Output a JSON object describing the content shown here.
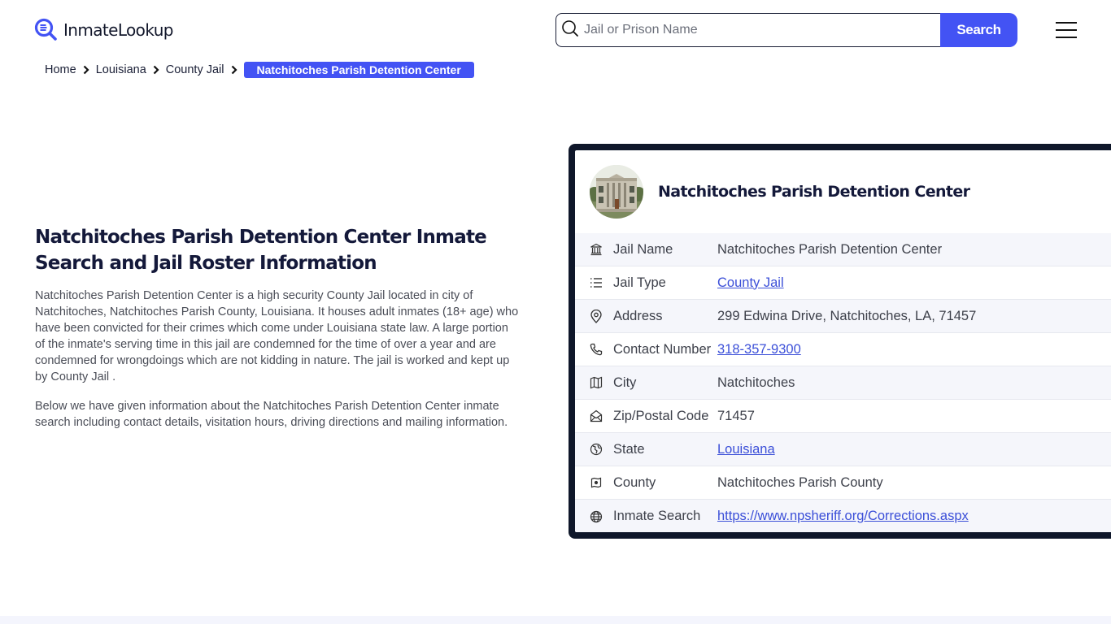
{
  "header": {
    "logo_text": "InmateLookup",
    "search": {
      "placeholder": "Jail or Prison Name",
      "value": "",
      "button_label": "Search"
    },
    "menu_icon": "hamburger-menu-icon"
  },
  "breadcrumb": {
    "items": [
      {
        "label": "Home"
      },
      {
        "label": "Louisiana"
      },
      {
        "label": "County Jail"
      }
    ],
    "current": "Natchitoches Parish Detention Center"
  },
  "intro": {
    "title": "Natchitoches Parish Detention Center Inmate Search and Jail Roster Information",
    "paragraphs": [
      "Natchitoches Parish Detention Center is a high security County Jail located in city of Natchitoches, Natchitoches Parish County, Louisiana. It houses adult inmates (18+ age) who have been convicted for their crimes which come under Louisiana state law. A large portion of the inmate's serving time in this jail are condemned for the time of over a year and are condemned for wrongdoings which are not kidding in nature. The jail is worked and kept up by County Jail .",
      "Below we have given information about the Natchitoches Parish Detention Center inmate search including contact details, visitation hours, driving directions and mailing information."
    ]
  },
  "card": {
    "title": "Natchitoches Parish Detention Center",
    "rows": [
      {
        "icon": "bank-building-icon",
        "label": "Jail Name",
        "value": "Natchitoches Parish Detention Center",
        "link": false
      },
      {
        "icon": "list-icon",
        "label": "Jail Type",
        "value": "County Jail",
        "link": true
      },
      {
        "icon": "map-pin-icon",
        "label": "Address",
        "value": "299 Edwina Drive, Natchitoches, LA, 71457",
        "link": false
      },
      {
        "icon": "phone-icon",
        "label": "Contact Number",
        "value": "318-357-9300",
        "link": true
      },
      {
        "icon": "map-icon",
        "label": "City",
        "value": "Natchitoches",
        "link": false
      },
      {
        "icon": "mail-open-icon",
        "label": "Zip/Postal Code",
        "value": "71457",
        "link": false
      },
      {
        "icon": "globe-region-icon",
        "label": "State",
        "value": "Louisiana",
        "link": true
      },
      {
        "icon": "county-map-icon",
        "label": "County",
        "value": "Natchitoches Parish County",
        "link": false
      },
      {
        "icon": "globe-icon",
        "label": "Inmate Search",
        "value": "https://www.npsheriff.org/Corrections.aspx",
        "link": true
      }
    ]
  },
  "colors": {
    "accent": "#4353f4",
    "card_border": "#0f172a",
    "link": "#3b4fd8",
    "title": "#14193a"
  }
}
